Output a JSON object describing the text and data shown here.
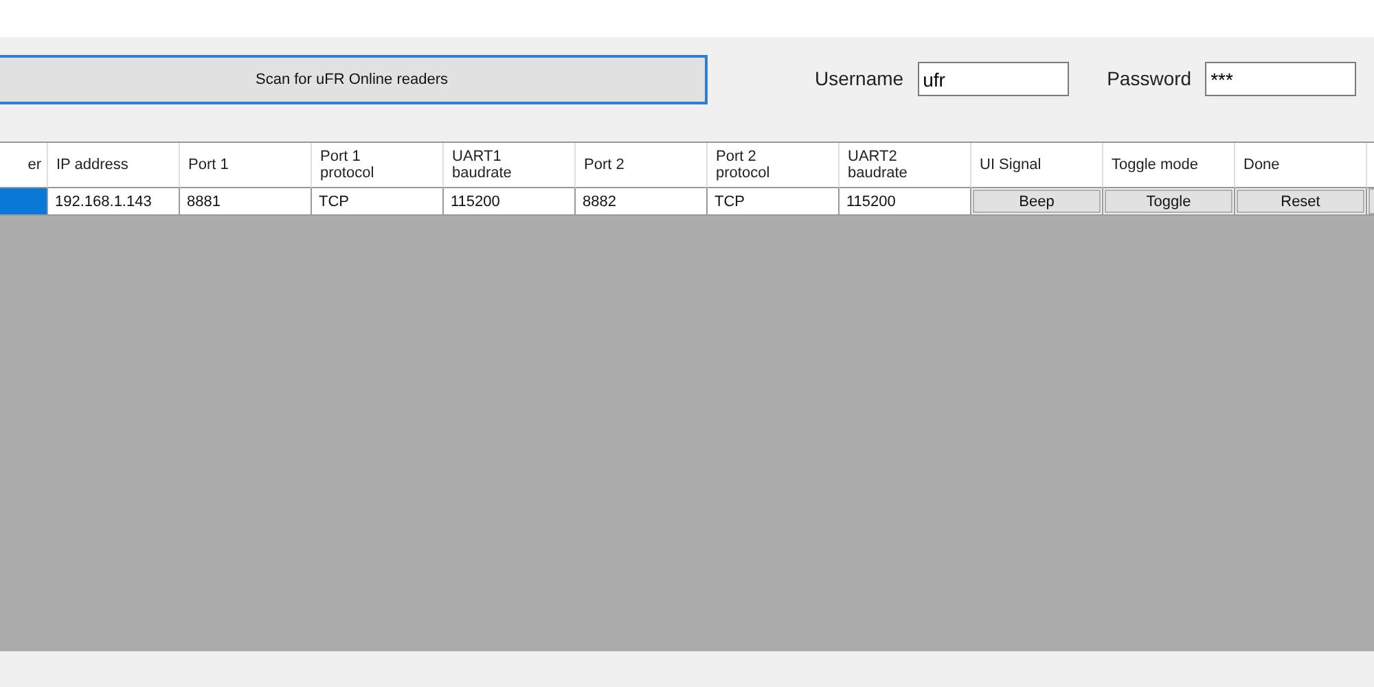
{
  "scan_button": "Scan for uFR Online readers",
  "username": {
    "label": "Username",
    "value": "ufr"
  },
  "password": {
    "label": "Password",
    "value": "***"
  },
  "table": {
    "columns": [
      "er",
      "IP address",
      "Port 1",
      "Port 1\nprotocol",
      "UART1\nbaudrate",
      "Port 2",
      "Port 2\nprotocol",
      "UART2\nbaudrate",
      "UI Signal",
      "Toggle mode",
      "Done"
    ],
    "rows": [
      {
        "cells": [
          {
            "kind": "blank",
            "selected": true
          },
          {
            "kind": "text",
            "text": "192.168.1.143"
          },
          {
            "kind": "text",
            "text": "8881"
          },
          {
            "kind": "text",
            "text": "TCP"
          },
          {
            "kind": "text",
            "text": "115200"
          },
          {
            "kind": "text",
            "text": "8882"
          },
          {
            "kind": "text",
            "text": "TCP"
          },
          {
            "kind": "text",
            "text": "115200"
          },
          {
            "kind": "button",
            "text": "Beep"
          },
          {
            "kind": "button",
            "text": "Toggle"
          },
          {
            "kind": "button",
            "text": "Reset"
          }
        ]
      }
    ]
  }
}
